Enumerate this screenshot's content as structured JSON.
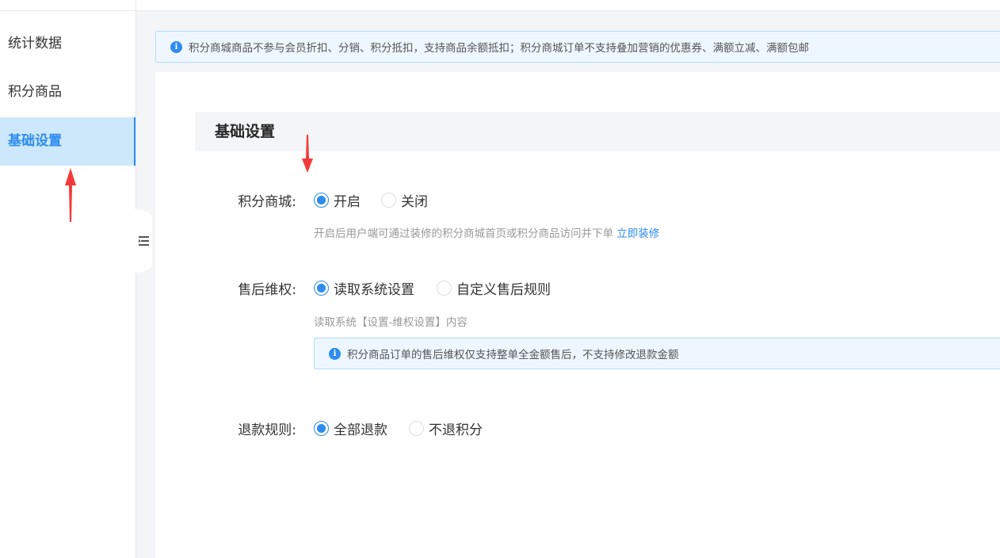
{
  "sidebar": {
    "items": [
      {
        "label": "统计数据",
        "active": false
      },
      {
        "label": "积分商品",
        "active": false
      },
      {
        "label": "基础设置",
        "active": true
      }
    ]
  },
  "notice": {
    "text": "积分商城商品不参与会员折扣、分销、积分抵扣，支持商品余额抵扣；积分商城订单不支持叠加营销的优惠券、满额立减、满额包邮"
  },
  "section": {
    "title": "基础设置"
  },
  "points_mall": {
    "label": "积分商城:",
    "options": [
      "开启",
      "关闭"
    ],
    "selected": "开启",
    "hint": "开启后用户端可通过装修的积分商城首页或积分商品访问并下单",
    "hint_link": "立即装修"
  },
  "after_sale": {
    "label": "售后维权:",
    "options": [
      "读取系统设置",
      "自定义售后规则"
    ],
    "selected": "读取系统设置",
    "hint": "读取系统【设置-维权设置】内容",
    "notice": "积分商品订单的售后维权仅支持整单全金额售后，不支持修改退款金额"
  },
  "refund_rule": {
    "label": "退款规则:",
    "options": [
      "全部退款",
      "不退积分"
    ],
    "selected": "全部退款"
  },
  "colors": {
    "accent": "#2d8cf0",
    "annotation_arrow": "#f23a3a"
  },
  "icons": {
    "info": "info-circle-icon",
    "collapse": "menu-collapse-icon"
  }
}
